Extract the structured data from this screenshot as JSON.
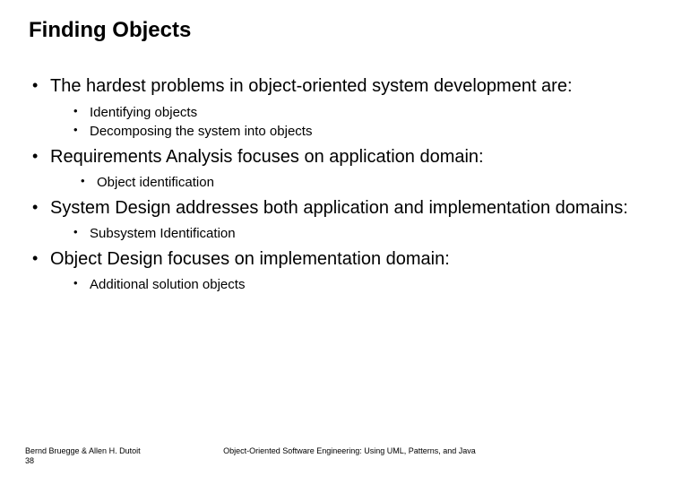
{
  "title": "Finding Objects",
  "bullets": {
    "b0": "The hardest problems in object-oriented system development are:",
    "b0_sub0": "Identifying objects",
    "b0_sub1": "Decomposing the system into objects",
    "b1": "Requirements Analysis focuses on application domain:",
    "b1_sub0": "Object identification",
    "b2": "System Design addresses both application and implementation domains:",
    "b2_sub0": "Subsystem Identification",
    "b3": "Object Design focuses on implementation domain:",
    "b3_sub0": "Additional solution objects"
  },
  "footer": {
    "authors": "Bernd Bruegge & Allen H. Dutoit",
    "page": "38",
    "booktitle": "Object-Oriented Software Engineering: Using UML, Patterns, and Java"
  }
}
